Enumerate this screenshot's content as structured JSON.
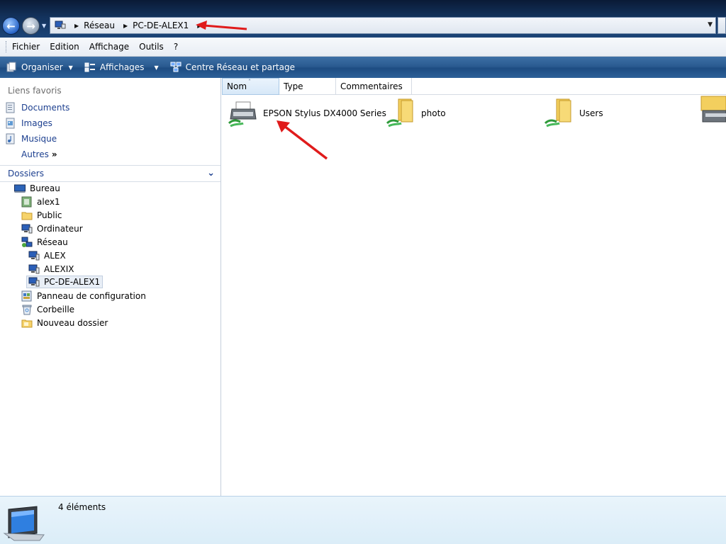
{
  "address": {
    "segments": [
      "Réseau",
      "PC-DE-ALEX1"
    ]
  },
  "menu": [
    "Fichier",
    "Edition",
    "Affichage",
    "Outils",
    "?"
  ],
  "toolbar": {
    "organize": "Organiser",
    "views": "Affichages",
    "network_center": "Centre Réseau et partage"
  },
  "favorites": {
    "title": "Liens favoris",
    "items": [
      "Documents",
      "Images",
      "Musique"
    ],
    "more": "Autres",
    "more_glyph": "»"
  },
  "folders": {
    "title": "Dossiers",
    "tree": [
      "Bureau",
      "alex1",
      "Public",
      "Ordinateur",
      "Réseau",
      "ALEX",
      "ALEXIX",
      "PC-DE-ALEX1",
      "Panneau de configuration",
      "Corbeille",
      "Nouveau dossier"
    ]
  },
  "columns": [
    "Nom",
    "Type",
    "Commentaires"
  ],
  "items": [
    {
      "name": "EPSON Stylus DX4000 Series",
      "icon": "printer-icon"
    },
    {
      "name": "photo",
      "icon": "shared-folder-icon"
    },
    {
      "name": "Users",
      "icon": "shared-folder-icon"
    }
  ],
  "status": {
    "count": "4 éléments"
  },
  "colors": {
    "title_bar": "#13325c",
    "command_bar": "#2a5b91",
    "link": "#1c3f8f",
    "annotation_arrow": "#e01b1b"
  }
}
